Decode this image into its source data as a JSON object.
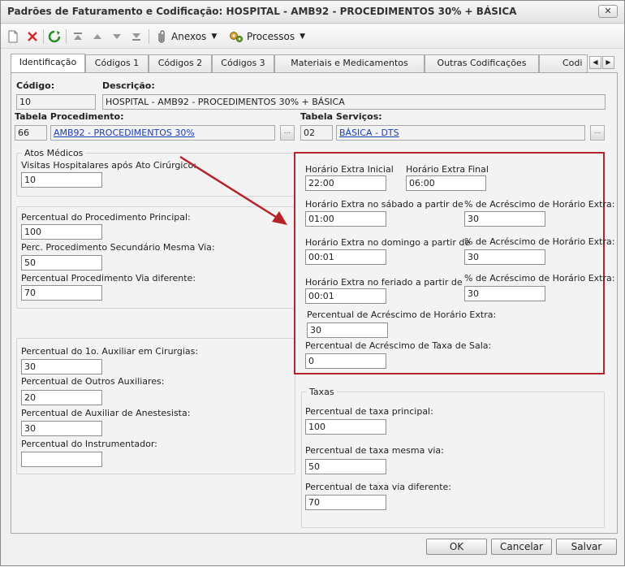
{
  "window": {
    "title": "Padrões de Faturamento e Codificação: HOSPITAL - AMB92 - PROCEDIMENTOS 30% + BÁSICA",
    "close_glyph": "✕"
  },
  "toolbar": {
    "anexos_label": "Anexos",
    "processos_label": "Processos"
  },
  "tabs": [
    {
      "label": "Identificação"
    },
    {
      "label": "Códigos 1"
    },
    {
      "label": "Códigos 2"
    },
    {
      "label": "Códigos 3"
    },
    {
      "label": "Materiais e Medicamentos"
    },
    {
      "label": "Outras Codificações"
    },
    {
      "label": "Codi"
    }
  ],
  "header": {
    "codigo_label": "Código:",
    "codigo_value": "10",
    "descricao_label": "Descrição:",
    "descricao_value": "HOSPITAL - AMB92 - PROCEDIMENTOS 30% + BÁSICA",
    "tabela_proc_label": "Tabela Procedimento:",
    "tabela_proc_code": "66",
    "tabela_proc_name": "AMB92 - PROCEDIMENTOS 30%",
    "tabela_serv_label": "Tabela Serviços:",
    "tabela_serv_code": "02",
    "tabela_serv_name": "BÁSICA - DTS",
    "ellipsis": "..."
  },
  "atos_medicos": {
    "legend": "Atos Médicos",
    "visitas_label": "Visitas Hospitalares após Ato Cirúrgico:",
    "visitas_value": "10"
  },
  "percentuais": {
    "principal_label": "Percentual do Procedimento Principal:",
    "principal_value": "100",
    "secundario_label": "Perc. Procedimento Secundário Mesma Via:",
    "secundario_value": "50",
    "via_diferente_label": "Percentual Procedimento Via diferente:",
    "via_diferente_value": "70"
  },
  "auxiliares": {
    "aux1_label": "Percentual do 1o. Auxiliar em Cirurgias:",
    "aux1_value": "30",
    "outros_label": "Percentual de Outros Auxiliares:",
    "outros_value": "20",
    "anest_label": "Percentual de Auxiliar de Anestesista:",
    "anest_value": "30",
    "instr_label": "Percentual do Instrumentador:",
    "instr_value": ""
  },
  "horario": {
    "inicial_label": "Horário Extra Inicial",
    "inicial_value": "22:00",
    "final_label": "Horário Extra Final",
    "final_value": "06:00",
    "sabado_label": "Horário Extra no sábado a partir de",
    "sabado_value": "01:00",
    "acresc_label": "% de Acréscimo de Horário Extra:",
    "sabado_acresc": "30",
    "domingo_label": "Horário Extra no domingo a partir de",
    "domingo_value": "00:01",
    "domingo_acresc": "30",
    "feriado_label": "Horário Extra no feriado a partir de",
    "feriado_value": "00:01",
    "feriado_acresc": "30",
    "perc_acresc_label": "Percentual de Acréscimo de Horário Extra:",
    "perc_acresc_value": "30",
    "taxa_sala_label": "Percentual de Acréscimo de Taxa de Sala:",
    "taxa_sala_value": "0"
  },
  "taxas": {
    "legend": "Taxas",
    "principal_label": "Percentual de taxa principal:",
    "principal_value": "100",
    "mesma_via_label": "Percentual de taxa mesma via:",
    "mesma_via_value": "50",
    "via_diferente_label": "Percentual de taxa via diferente:",
    "via_diferente_value": "70"
  },
  "footer": {
    "ok_label": "OK",
    "cancel_label": "Cancelar",
    "save_label": "Salvar"
  },
  "colors": {
    "highlight": "#b5252c",
    "arrow": "#b5252c",
    "link": "#1a3fb8"
  }
}
